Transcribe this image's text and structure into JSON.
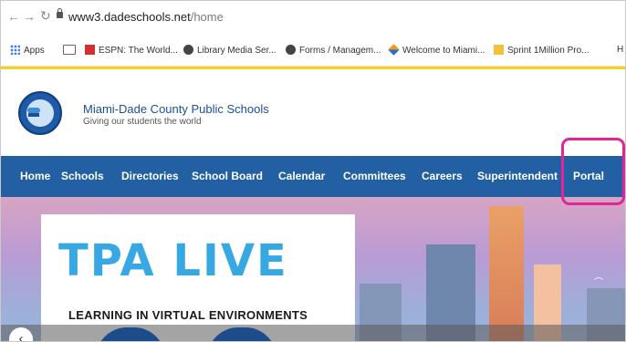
{
  "browser": {
    "url_host": "www3.dadeschools.net",
    "url_path": "/home",
    "bookmarks": [
      {
        "label": "Apps"
      },
      {
        "label": "ESPN: The World..."
      },
      {
        "label": "Library Media Ser..."
      },
      {
        "label": "Forms / Managem..."
      },
      {
        "label": "Welcome to Miami..."
      },
      {
        "label": "Sprint 1Million Pro..."
      },
      {
        "label": "H"
      }
    ]
  },
  "site": {
    "name": "Miami-Dade County Public Schools",
    "tagline": "Giving our students the world"
  },
  "nav": {
    "items": [
      "Home",
      "Schools",
      "Directories",
      "School Board",
      "Calendar",
      "Committees",
      "Careers",
      "Superintendent",
      "Portal"
    ],
    "highlight_color": "#e0259a",
    "bar_color": "#235fa3"
  },
  "hero": {
    "title": "TPA LIVE",
    "subtitle": "LEARNING IN VIRTUAL ENVIRONMENTS",
    "prev_label": "‹"
  }
}
